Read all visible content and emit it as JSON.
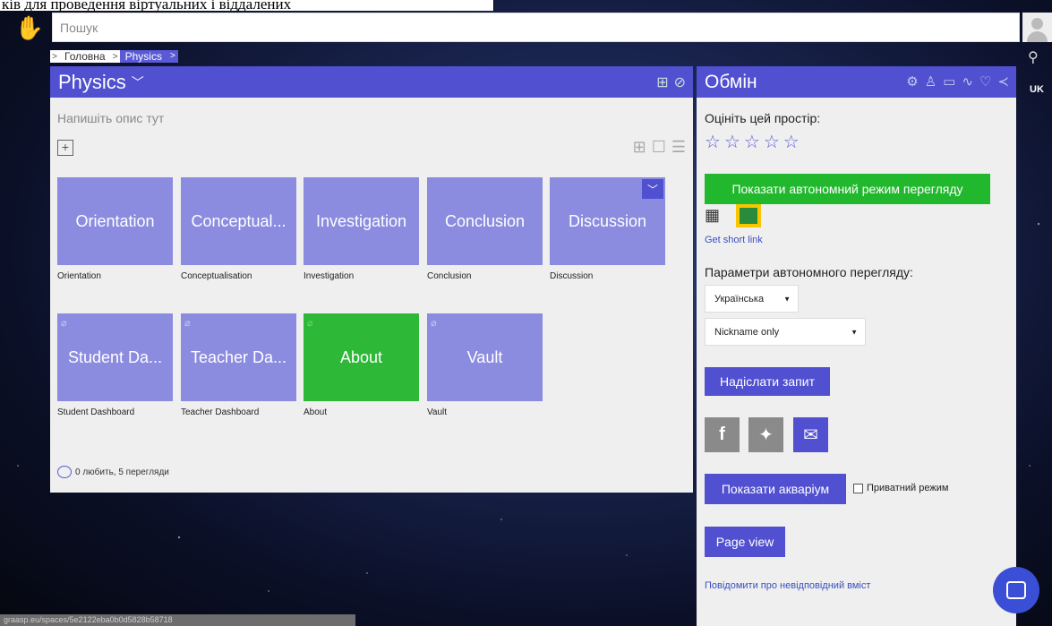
{
  "top_strip": {
    "text": "ків для проведення віртуальних і віддалених"
  },
  "search": {
    "placeholder": "Пошук"
  },
  "lang": "UK",
  "breadcrumb": {
    "home": "Головна",
    "current": "Physics"
  },
  "main": {
    "title": "Physics",
    "description_placeholder": "Напишіть опис тут",
    "tiles": [
      {
        "label": "Orientation",
        "caption": "Orientation",
        "hidden": false,
        "color": "#8b8be0"
      },
      {
        "label": "Conceptual...",
        "caption": "Conceptualisation",
        "hidden": false,
        "color": "#8b8be0"
      },
      {
        "label": "Investigation",
        "caption": "Investigation",
        "hidden": false,
        "color": "#8b8be0"
      },
      {
        "label": "Conclusion",
        "caption": "Conclusion",
        "hidden": false,
        "color": "#8b8be0"
      },
      {
        "label": "Discussion",
        "caption": "Discussion",
        "hidden": false,
        "color": "#8b8be0"
      },
      {
        "label": "Student Da...",
        "caption": "Student Dashboard",
        "hidden": true,
        "color": "#8b8be0"
      },
      {
        "label": "Teacher Da...",
        "caption": "Teacher Dashboard",
        "hidden": true,
        "color": "#8b8be0"
      },
      {
        "label": "About",
        "caption": "About",
        "hidden": true,
        "color": "#2db837"
      },
      {
        "label": "Vault",
        "caption": "Vault",
        "hidden": true,
        "color": "#8b8be0"
      }
    ],
    "likes_text": "0 любить, 5 перегляди"
  },
  "sidebar": {
    "title": "Обмін",
    "rate_label": "Оцініть цей простір:",
    "offline_button": "Показати автономний режим перегляду",
    "short_link": "Get short link",
    "params_label": "Параметри автономного перегляду:",
    "language_select": "Українська",
    "nickname_select": "Nickname only",
    "request_button": "Надіслати запит",
    "aquarium_button": "Показати акваріум",
    "private_mode": "Приватний режим",
    "page_view_button": "Page view",
    "report_link": "Повідомити про невідповідний вміст"
  },
  "status_url": "graasp.eu/spaces/5e2122eba0b0d5828b58718"
}
